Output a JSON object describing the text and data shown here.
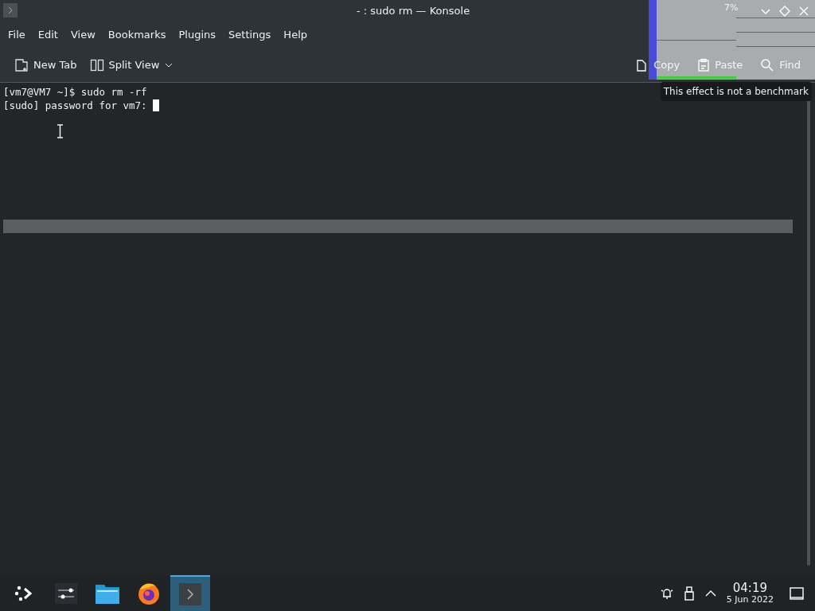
{
  "window": {
    "title": "- : sudo rm — Konsole"
  },
  "menu": [
    "File",
    "Edit",
    "View",
    "Bookmarks",
    "Plugins",
    "Settings",
    "Help"
  ],
  "toolbar": [
    {
      "kind": "newtab",
      "label": "New Tab"
    },
    {
      "kind": "split",
      "label": "Split View"
    },
    {
      "kind": "copy",
      "label": "Copy"
    },
    {
      "kind": "paste",
      "label": "Paste"
    },
    {
      "kind": "find",
      "label": "Find"
    }
  ],
  "overlay": {
    "text": "7%"
  },
  "terminal": {
    "lines": [
      "[vm7@VM7 ~]$ sudo rm -rf",
      "[sudo] password for vm7: "
    ]
  },
  "tooltip": "This effect is not a benchmark",
  "taskbar": {
    "apps": [
      {
        "kind": "launcher",
        "selected": false
      },
      {
        "kind": "settings",
        "selected": false
      },
      {
        "kind": "files",
        "selected": false
      },
      {
        "kind": "browser",
        "selected": false
      },
      {
        "kind": "terminal",
        "selected": true
      }
    ],
    "clock": {
      "time": "04:19",
      "date": "5 Jun 2022"
    }
  }
}
